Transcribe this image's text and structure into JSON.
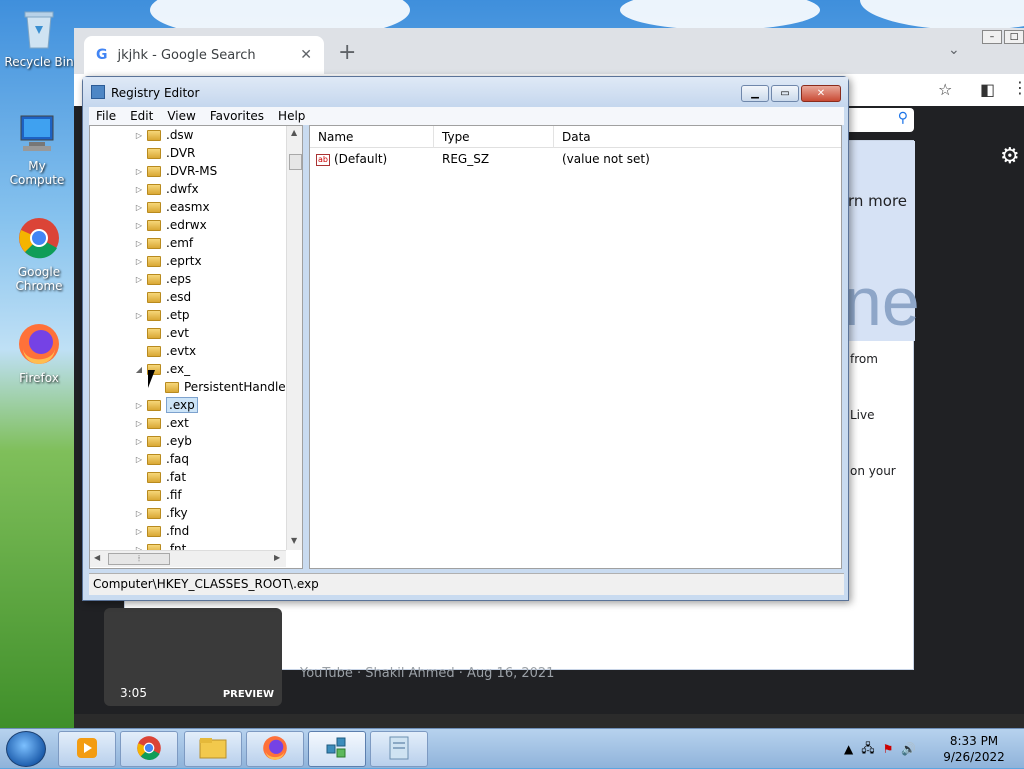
{
  "desktop": {
    "icons": [
      {
        "label": "Recycle Bin",
        "icon": "recycle-bin-icon"
      },
      {
        "label": "My Compute",
        "icon": "computer-icon"
      },
      {
        "label": "Google Chrome",
        "icon": "chrome-icon"
      },
      {
        "label": "Firefox",
        "icon": "firefox-icon"
      }
    ]
  },
  "chrome": {
    "tab_title": "jkjhk - Google Search",
    "tab_favicon": "G",
    "content": {
      "learn_more": "rn more",
      "big_text": "ne",
      "from": "from",
      "live": "Live",
      "on_your": "on your",
      "video_duration": "3:05",
      "video_preview": "PREVIEW",
      "video_meta": "YouTube · Shakil Ahmed · Aug 16, 2021"
    }
  },
  "regedit": {
    "title": "Registry Editor",
    "menu": [
      "File",
      "Edit",
      "View",
      "Favorites",
      "Help"
    ],
    "tree": [
      {
        "label": ".dsw",
        "expandable": true
      },
      {
        "label": ".DVR",
        "expandable": false
      },
      {
        "label": ".DVR-MS",
        "expandable": true
      },
      {
        "label": ".dwfx",
        "expandable": true
      },
      {
        "label": ".easmx",
        "expandable": true
      },
      {
        "label": ".edrwx",
        "expandable": true
      },
      {
        "label": ".emf",
        "expandable": true
      },
      {
        "label": ".eprtx",
        "expandable": true
      },
      {
        "label": ".eps",
        "expandable": true
      },
      {
        "label": ".esd",
        "expandable": false
      },
      {
        "label": ".etp",
        "expandable": true
      },
      {
        "label": ".evt",
        "expandable": false
      },
      {
        "label": ".evtx",
        "expandable": false
      },
      {
        "label": ".ex_",
        "expandable": true,
        "expanded": true
      },
      {
        "label": "PersistentHandler",
        "expandable": false,
        "child": true
      },
      {
        "label": ".exp",
        "expandable": true,
        "selected": true
      },
      {
        "label": ".ext",
        "expandable": true
      },
      {
        "label": ".eyb",
        "expandable": true
      },
      {
        "label": ".faq",
        "expandable": true
      },
      {
        "label": ".fat",
        "expandable": false
      },
      {
        "label": ".fif",
        "expandable": false
      },
      {
        "label": ".fky",
        "expandable": true
      },
      {
        "label": ".fnd",
        "expandable": true
      },
      {
        "label": ".fnt",
        "expandable": true
      }
    ],
    "columns": {
      "name": "Name",
      "type": "Type",
      "data": "Data"
    },
    "values": [
      {
        "name": "(Default)",
        "type": "REG_SZ",
        "data": "(value not set)",
        "icon": "ab"
      }
    ],
    "status": "Computer\\HKEY_CLASSES_ROOT\\.exp"
  },
  "taskbar": {
    "clock_time": "8:33 PM",
    "clock_date": "9/26/2022",
    "buttons": [
      "media-player-icon",
      "chrome-icon",
      "explorer-icon",
      "firefox-icon",
      "regedit-icon",
      "document-icon"
    ]
  }
}
